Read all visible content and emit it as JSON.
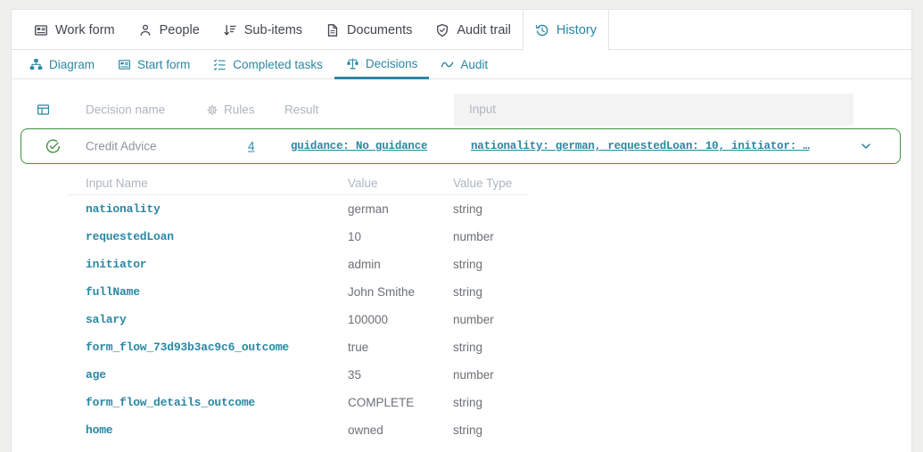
{
  "colors": {
    "teal": "#2a88a4",
    "green": "#3f9142",
    "input_header_bg": "#f3f3f3",
    "page_bg": "#efefee"
  },
  "tabs_primary": {
    "items": [
      {
        "label": "Work form",
        "icon": "work-form-icon",
        "active": false
      },
      {
        "label": "People",
        "icon": "people-icon",
        "active": false
      },
      {
        "label": "Sub-items",
        "icon": "sub-items-icon",
        "active": false
      },
      {
        "label": "Documents",
        "icon": "documents-icon",
        "active": false
      },
      {
        "label": "Audit trail",
        "icon": "shield-check-icon",
        "active": false
      },
      {
        "label": "History",
        "icon": "history-icon",
        "active": true
      }
    ]
  },
  "tabs_secondary": {
    "items": [
      {
        "label": "Diagram",
        "icon": "sitemap-icon",
        "active": false
      },
      {
        "label": "Start form",
        "icon": "start-form-icon",
        "active": false
      },
      {
        "label": "Completed tasks",
        "icon": "task-list-icon",
        "active": false
      },
      {
        "label": "Decisions",
        "icon": "scales-icon",
        "active": true
      },
      {
        "label": "Audit",
        "icon": "pulse-icon",
        "active": false
      }
    ]
  },
  "decision_table": {
    "headers": {
      "table_icon": "table-icon",
      "decision_name": "Decision name",
      "rules_icon": "gear-icon",
      "rules": "Rules",
      "result": "Result",
      "input": "Input"
    },
    "row": {
      "status_icon": "check-circle-icon",
      "decision_name": "Credit Advice",
      "rules_count": "4",
      "result_link": "guidance: No guidance",
      "input_link": "nationality: german, requestedLoan: 10, initiator: …",
      "expand_icon": "chevron-down-icon",
      "expanded": true
    }
  },
  "details": {
    "headers": [
      "Input Name",
      "Value",
      "Value Type"
    ],
    "rows": [
      {
        "name": "nationality",
        "value": "german",
        "type": "string"
      },
      {
        "name": "requestedLoan",
        "value": "10",
        "type": "number"
      },
      {
        "name": "initiator",
        "value": "admin",
        "type": "string"
      },
      {
        "name": "fullName",
        "value": "John Smithe",
        "type": "string"
      },
      {
        "name": "salary",
        "value": "100000",
        "type": "number"
      },
      {
        "name": "form_flow_73d93b3ac9c6_outcome",
        "value": "true",
        "type": "string"
      },
      {
        "name": "age",
        "value": "35",
        "type": "number"
      },
      {
        "name": "form_flow_details_outcome",
        "value": "COMPLETE",
        "type": "string"
      },
      {
        "name": "home",
        "value": "owned",
        "type": "string"
      }
    ]
  }
}
